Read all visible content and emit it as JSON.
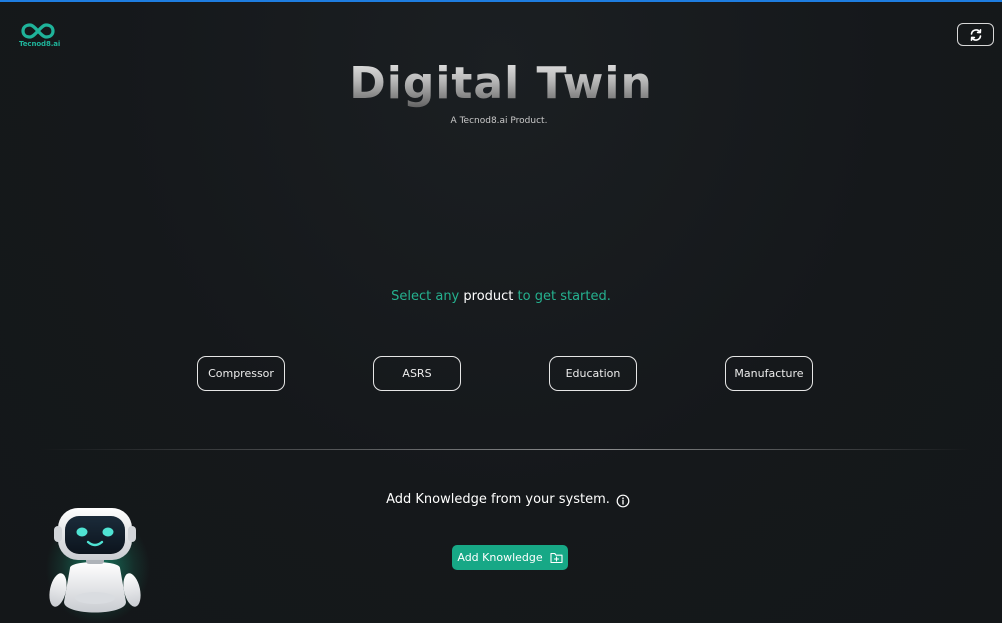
{
  "app": {
    "logo_text": "Tecnod8.ai",
    "title": "Digital Twin",
    "subtitle": "A Tecnod8.ai Product."
  },
  "prompt": {
    "before": "Select any",
    "emphasis": "product",
    "after": "to get started."
  },
  "products": [
    {
      "label": "Compressor"
    },
    {
      "label": "ASRS"
    },
    {
      "label": "Education"
    },
    {
      "label": "Manufacture"
    }
  ],
  "knowledge": {
    "heading": "Add Knowledge from your system.",
    "button_label": "Add Knowledge"
  },
  "icons": {
    "logo": "infinity-icon",
    "refresh": "refresh-icon",
    "info": "info-icon",
    "add_folder": "folder-plus-icon",
    "assistant": "robot-icon"
  },
  "colors": {
    "accent_bar": "#1e7de0",
    "brand_green": "#1fb39a",
    "button_green": "#17a886",
    "background": "#15181b"
  }
}
